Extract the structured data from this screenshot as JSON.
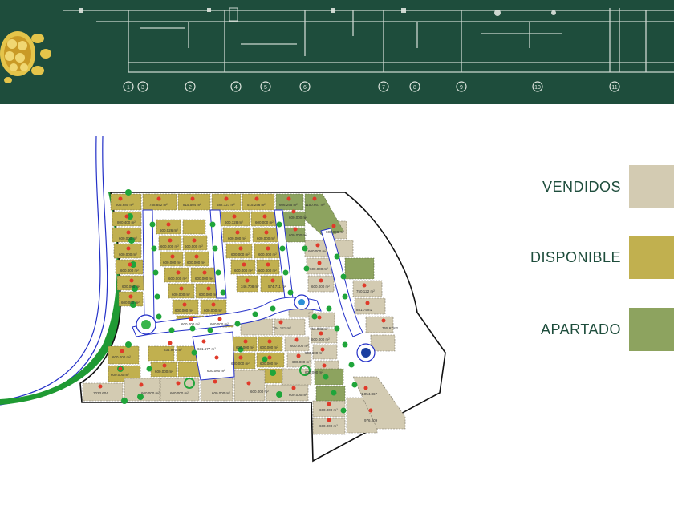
{
  "colors": {
    "banner_bg": "#1e4d3c",
    "vendidos": "#d3cbb2",
    "disponible": "#c1b04f",
    "apartado": "#8da35f",
    "trees": "#1fa53a",
    "lot_marker": "#e03a2a",
    "road_edge": "#2330c8"
  },
  "banner": {
    "logo_icon": "turtle-icon",
    "axis_markers": [
      "1",
      "3",
      "2",
      "4",
      "5",
      "6",
      "7",
      "8",
      "9",
      "10",
      "11"
    ]
  },
  "legend": [
    {
      "key": "vendidos",
      "label": "VENDIDOS"
    },
    {
      "key": "disponible",
      "label": "DISPONIBLE"
    },
    {
      "key": "apartado",
      "label": "APARTADO"
    }
  ],
  "lot_areas": [
    "805.680 m²",
    "758.852 m²",
    "815.504 m²",
    "582.127 m²",
    "515.246 m²",
    "606.295 m²",
    "1150.667 m²",
    "800.400 m²",
    "600.026 m²",
    "600.000 m²",
    "600.128 m²",
    "600.000 m²",
    "600.000 m²",
    "600.000 m²",
    "600.000 m²",
    "600.000 m²",
    "600.000 m²",
    "600.000 m²",
    "600.000 m²",
    "600.000 m²",
    "600.000 m²",
    "600.000 m²",
    "600.000 m²",
    "600.000 m²",
    "600.000 m²",
    "600.000 m²",
    "600.000 m²",
    "600.000 m²",
    "600.000 m²",
    "600.000 m²",
    "600.000 m²",
    "600.000 m²",
    "600.000 m²",
    "600.000 m²",
    "346.708 m²",
    "574.711 m²",
    "600.000 m²",
    "600.000 m²",
    "600.000 m²",
    "600.000 m²",
    "600.000 m²",
    "600.000 m²",
    "764.121 m²",
    "763.083 m²",
    "765.67m2",
    "600.000 m²",
    "600.000 m²",
    "600.000 m²",
    "834.970 m²",
    "631.677 m²",
    "600.000 m²",
    "600.000 m²",
    "600.000 m²",
    "600.000 m²",
    "600.000 m²",
    "600.000 m²",
    "600.000 m²",
    "1023.604",
    "600.000 m²",
    "600.000 m²",
    "600.000 m²",
    "600.000 m²",
    "600.000 m²",
    "600.000 m²",
    "1.054.867",
    "600.000 m²",
    "600.000 m²",
    "976.209",
    "600.000 m²",
    "600.000 m²",
    "750.122 m²",
    "851.75m2"
  ]
}
